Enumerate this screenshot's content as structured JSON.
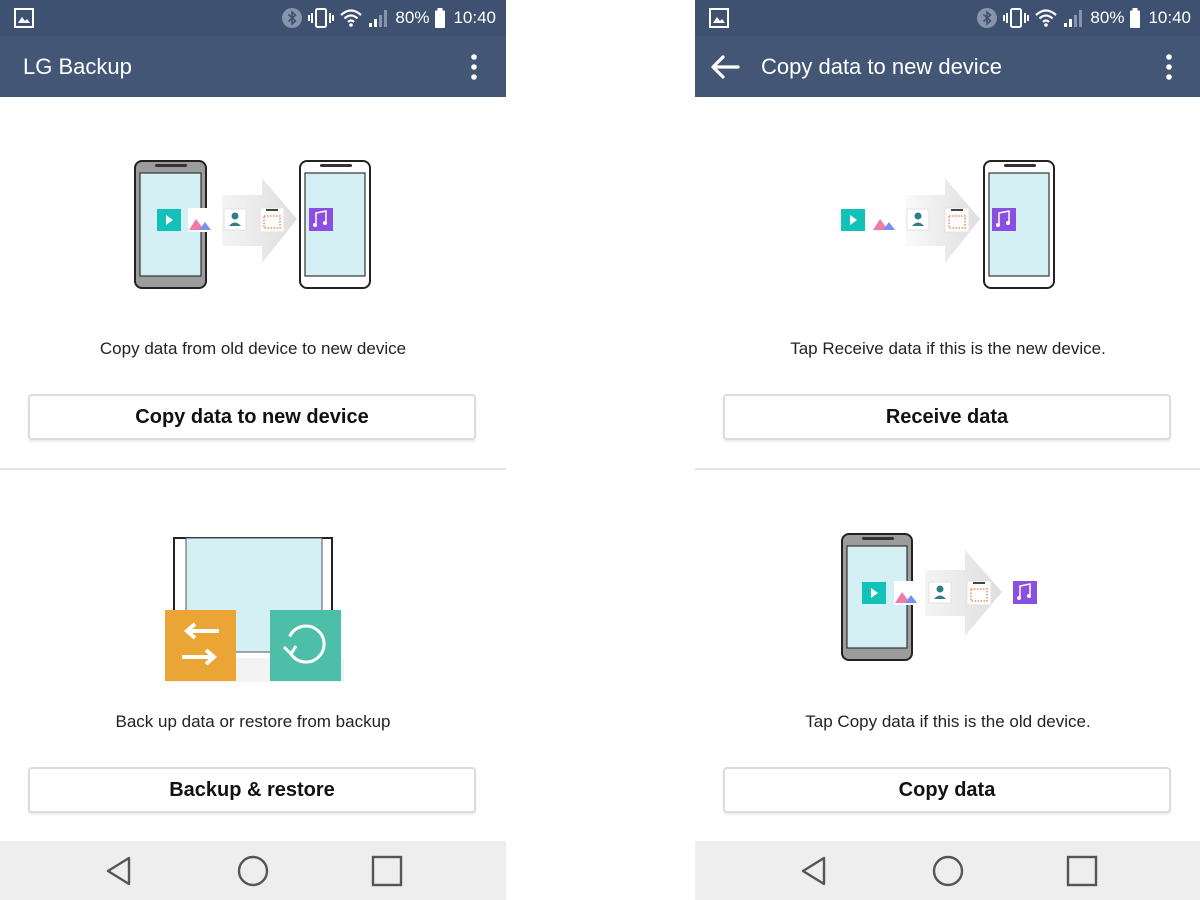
{
  "status_bar": {
    "battery_percent": "80%",
    "time": "10:40",
    "icons": [
      "gallery-icon",
      "bluetooth-icon",
      "vibrate-icon",
      "wifi-icon",
      "signal-icon",
      "battery-icon"
    ]
  },
  "left_screen": {
    "app_bar": {
      "title": "LG Backup"
    },
    "card_1": {
      "description": "Copy data from old device to new device",
      "button_label": "Copy data to new device"
    },
    "card_2": {
      "description": "Back up data or restore from backup",
      "button_label": "Backup & restore"
    }
  },
  "right_screen": {
    "app_bar": {
      "title": "Copy data to new device"
    },
    "card_1": {
      "description": "Tap Receive data if this is the new device.",
      "button_label": "Receive data"
    },
    "card_2": {
      "description": "Tap Copy data if this is the old device.",
      "button_label": "Copy data"
    }
  },
  "colors": {
    "status_bar": "#3f5170",
    "app_bar": "#435676",
    "video_icon": "#12c2b8",
    "music_icon": "#8a4fe0",
    "backup_tile": "#eba534",
    "restore_tile": "#4dbfa8",
    "screen_fill": "#d4f0f4",
    "nav_bar": "#eeeeee"
  }
}
